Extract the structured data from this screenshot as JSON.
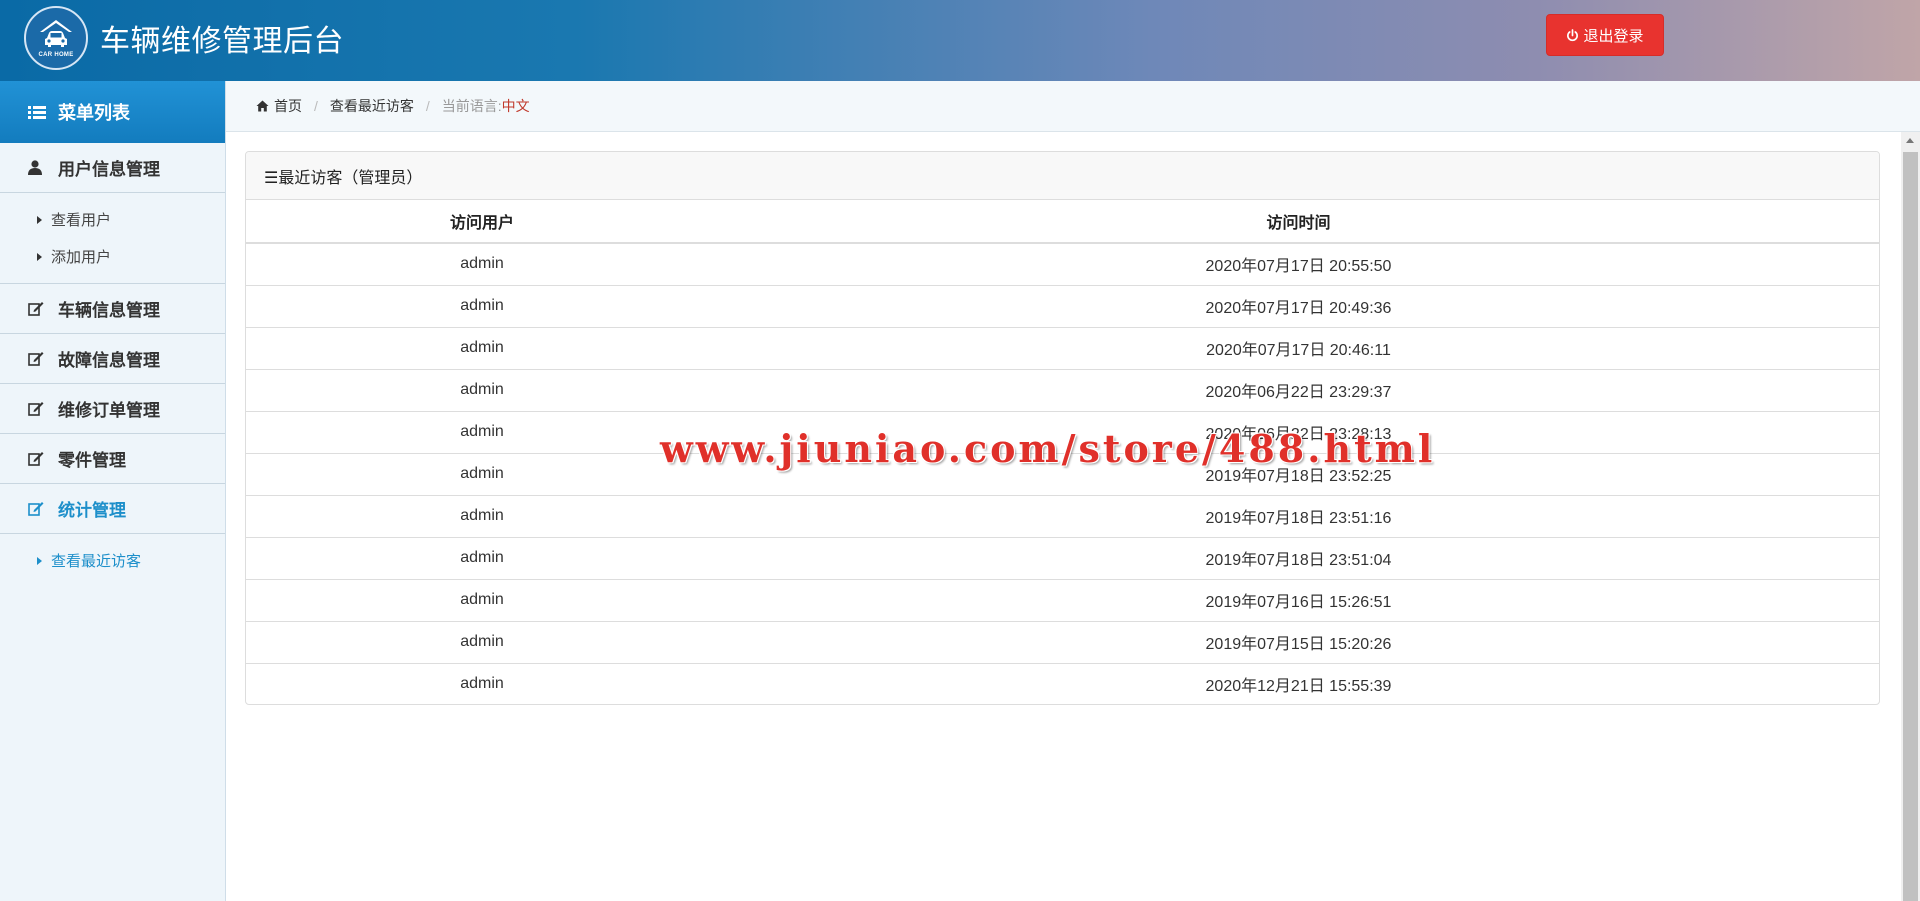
{
  "header": {
    "logo_text": "CAR HOME",
    "title": "车辆维修管理后台",
    "logout_label": "退出登录"
  },
  "sidebar": {
    "title": "菜单列表",
    "groups": [
      {
        "label": "用户信息管理",
        "icon": "user-icon",
        "items": [
          "查看用户",
          "添加用户"
        ]
      },
      {
        "label": "车辆信息管理",
        "icon": "edit-icon"
      },
      {
        "label": "故障信息管理",
        "icon": "edit-icon"
      },
      {
        "label": "维修订单管理",
        "icon": "edit-icon"
      },
      {
        "label": "零件管理",
        "icon": "edit-icon"
      },
      {
        "label": "统计管理",
        "icon": "edit-icon",
        "active": true,
        "items": [
          "查看最近访客"
        ]
      }
    ]
  },
  "breadcrumb": {
    "home": "首页",
    "current": "查看最近访客",
    "lang_label": "当前语言:",
    "lang_value": "中文"
  },
  "panel": {
    "title": "☰最近访客（管理员）",
    "columns": [
      "访问用户",
      "访问时间"
    ],
    "rows": [
      [
        "admin",
        "2020年07月17日 20:55:50"
      ],
      [
        "admin",
        "2020年07月17日 20:49:36"
      ],
      [
        "admin",
        "2020年07月17日 20:46:11"
      ],
      [
        "admin",
        "2020年06月22日 23:29:37"
      ],
      [
        "admin",
        "2020年06月22日 23:28:13"
      ],
      [
        "admin",
        "2019年07月18日 23:52:25"
      ],
      [
        "admin",
        "2019年07月18日 23:51:16"
      ],
      [
        "admin",
        "2019年07月18日 23:51:04"
      ],
      [
        "admin",
        "2019年07月16日 15:26:51"
      ],
      [
        "admin",
        "2019年07月15日 15:20:26"
      ],
      [
        "admin",
        "2020年12月21日 15:55:39"
      ]
    ]
  },
  "watermark": "www.jiuniao.com/store/488.html",
  "colors": {
    "accent": "#1d8fca",
    "logout": "#e8332f",
    "lang": "#c0392b",
    "watermark": "#e0302a"
  }
}
